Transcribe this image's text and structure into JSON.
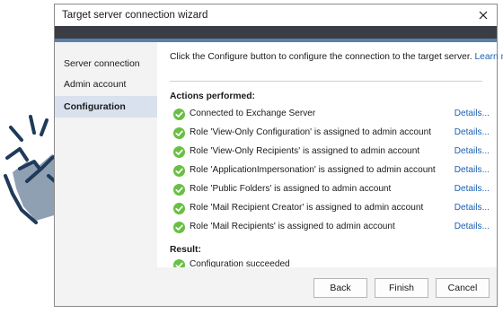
{
  "window": {
    "title": "Target server connection wizard",
    "close_icon": "close-icon"
  },
  "sidebar": {
    "items": [
      {
        "label": "Server connection",
        "active": false
      },
      {
        "label": "Admin account",
        "active": false
      },
      {
        "label": "Configuration",
        "active": true
      }
    ]
  },
  "main": {
    "intro": "Click the Configure button to configure the connection to the target server.",
    "learn_more": "Learn more.",
    "actions_title": "Actions performed:",
    "actions": [
      {
        "text": "Connected to Exchange Server",
        "details": "Details..."
      },
      {
        "text": "Role 'View-Only Configuration' is assigned to admin account",
        "details": "Details..."
      },
      {
        "text": "Role 'View-Only Recipients' is assigned to admin account",
        "details": "Details..."
      },
      {
        "text": "Role 'ApplicationImpersonation' is assigned to admin account",
        "details": "Details..."
      },
      {
        "text": "Role 'Public Folders' is assigned to admin account",
        "details": "Details..."
      },
      {
        "text": "Role 'Mail Recipient Creator' is assigned to admin account",
        "details": "Details..."
      },
      {
        "text": "Role 'Mail Recipients' is assigned to admin account",
        "details": "Details..."
      }
    ],
    "result_title": "Result:",
    "result_text": "Configuration succeeded"
  },
  "footer": {
    "back_label": "Back",
    "finish_label": "Finish",
    "cancel_label": "Cancel"
  },
  "colors": {
    "accent": "#5b7fa8",
    "link": "#1a5fb4",
    "success": "#6abf45",
    "active_sidebar": "#d9e1ef",
    "hand_fill": "#8fa0b3",
    "hand_outline": "#1f3a5a"
  },
  "decoration": {
    "hand_icon": "snapping-hand-icon"
  }
}
